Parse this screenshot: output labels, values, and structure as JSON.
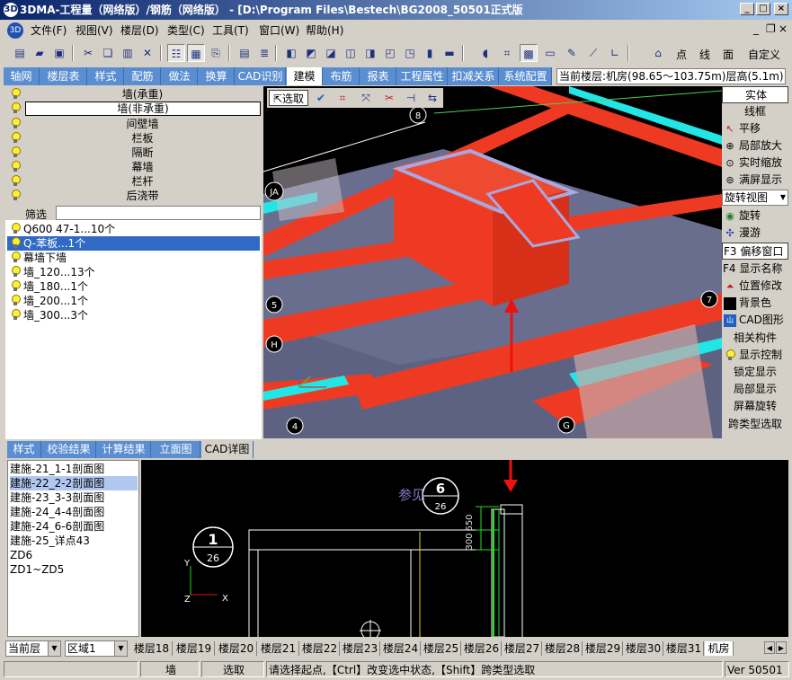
{
  "window": {
    "title": "3DMA-工程量（网络版）/钢筋（网络版） - [D:\\Program Files\\Bestech\\BG2008_50501正式版",
    "minimize": "_",
    "maximize": "□",
    "close": "×"
  },
  "menu": [
    "文件(F)",
    "视图(V)",
    "楼层(D)",
    "类型(C)",
    "工具(T)",
    "窗口(W)",
    "帮助(H)"
  ],
  "toolbar": {
    "point": "点",
    "line": "线",
    "face": "面",
    "custom": "自定义"
  },
  "tabs": [
    "轴网",
    "楼层表",
    "样式",
    "配筋",
    "做法",
    "换算",
    "CAD识别",
    "建模",
    "布筋",
    "报表",
    "工程属性",
    "扣减关系",
    "系统配置"
  ],
  "active_tab": "建模",
  "floor_info": "当前楼层:机房(98.65～103.75m)层高(5.1m)",
  "categories": [
    "墙(承重)",
    "墙(非承重)",
    "间壁墙",
    "栏板",
    "隔断",
    "幕墙",
    "栏杆",
    "后浇带"
  ],
  "filter_label": "筛选",
  "components": [
    "Q600 47-1...10个",
    "Q-苯板...1个",
    "幕墙下墙",
    "墙_120...13个",
    "墙_180...1个",
    "墙_200...1个",
    "墙_300...3个"
  ],
  "viewport": {
    "tools": {
      "select": "选取"
    },
    "axis_labels": [
      "8",
      "JA",
      "5",
      "H",
      "4",
      "7",
      "G"
    ]
  },
  "right_panel": {
    "solid": "实体",
    "wireframe": "线框",
    "pan": "平移",
    "zoom_local": "局部放大",
    "zoom_realtime": "实时缩放",
    "zoom_full": "满屏显示",
    "rotate_view": "旋转视图",
    "rotate": "旋转",
    "roam": "漫游",
    "f3_offset": "F3 偏移窗口",
    "f4_names": "F4 显示名称",
    "pos_modify": "位置修改",
    "background": "背景色",
    "cad_graphic": "CAD图形",
    "related": "相关构件",
    "display_control": "显示控制",
    "lock_display": "锁定显示",
    "local_display": "局部显示",
    "screen_rotate": "屏幕旋转",
    "cross_select": "跨类型选取"
  },
  "bottom_tabs": [
    "样式",
    "校验结果",
    "计算结果",
    "立面图",
    "CAD详图"
  ],
  "active_bottom_tab": "CAD详图",
  "drawings": [
    "建施-21_1-1剖面图",
    "建施-22_2-2剖面图",
    "建施-23_3-3剖面图",
    "建施-24_4-4剖面图",
    "建施-24_6-6剖面图",
    "建施-25_详点43",
    "ZD6",
    "ZD1~ZD5"
  ],
  "cad": {
    "ref_text": "参见",
    "callout_left_top": "1",
    "callout_left_bottom": "26",
    "callout_right_top": "6",
    "callout_right_bottom": "26",
    "dim_650": "650",
    "dim_300": "300",
    "axis_y": "Y",
    "axis_x": "X",
    "axis_z": "Z"
  },
  "floor_selector": {
    "scope": "当前层",
    "region": "区域1"
  },
  "floors": [
    "楼层18",
    "楼层19",
    "楼层20",
    "楼层21",
    "楼层22",
    "楼层23",
    "楼层24",
    "楼层25",
    "楼层26",
    "楼层27",
    "楼层28",
    "楼层29",
    "楼层30",
    "楼层31",
    "机房"
  ],
  "active_floor": "机房",
  "status": {
    "type": "墙",
    "mode": "选取",
    "hint": "请选择起点,【Ctrl】改变选中状态,【Shift】跨类型选取",
    "version": "Ver 50501"
  },
  "colors": {
    "beam_red": "#ee3a22",
    "slab_gray": "#6a6e8e",
    "cyan_edge": "#22e6e6",
    "tab_blue": "#5a8ed0",
    "annotation_arrow": "#ee1111"
  }
}
